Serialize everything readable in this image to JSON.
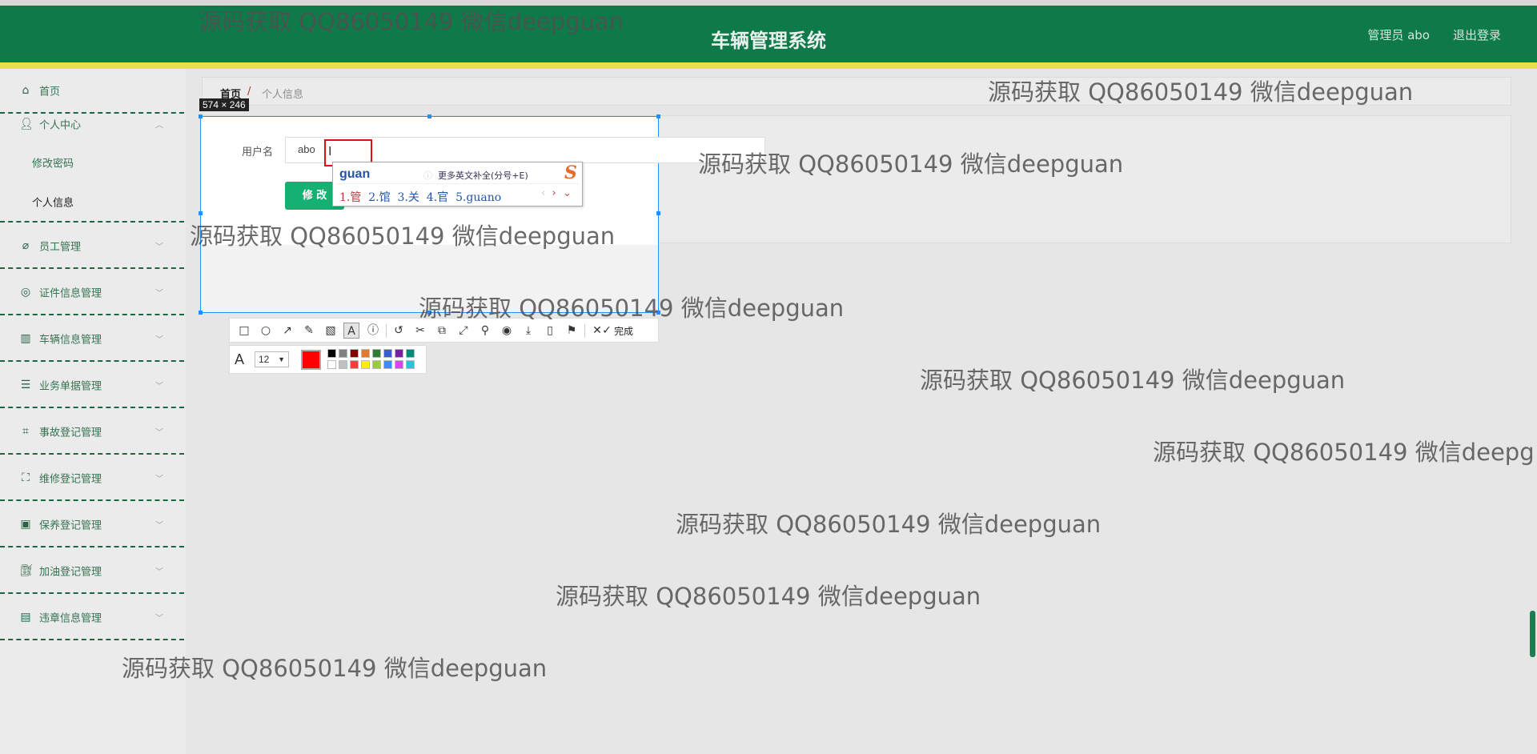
{
  "header": {
    "title": "车辆管理系统",
    "user_label": "管理员 abo",
    "logout_label": "退出登录"
  },
  "sidebar": {
    "items": [
      {
        "label": "首页",
        "icon": "home-icon"
      },
      {
        "label": "个人中心",
        "icon": "user-icon",
        "expanded": true,
        "children": [
          {
            "label": "修改密码"
          },
          {
            "label": "个人信息",
            "active": true
          }
        ]
      },
      {
        "label": "员工管理",
        "icon": "staff-icon"
      },
      {
        "label": "证件信息管理",
        "icon": "certificate-icon"
      },
      {
        "label": "车辆信息管理",
        "icon": "chart-icon"
      },
      {
        "label": "业务单据管理",
        "icon": "list-icon"
      },
      {
        "label": "事故登记管理",
        "icon": "crop-icon"
      },
      {
        "label": "维修登记管理",
        "icon": "frame-icon"
      },
      {
        "label": "保养登记管理",
        "icon": "card-icon"
      },
      {
        "label": "加油登记管理",
        "icon": "fuel-icon"
      },
      {
        "label": "违章信息管理",
        "icon": "report-icon"
      }
    ]
  },
  "breadcrumb": {
    "home": "首页",
    "separator": "/",
    "current": "个人信息"
  },
  "form": {
    "username_label": "用户名",
    "username_value": "abo",
    "submit_label": "修 改"
  },
  "snip": {
    "size_label": "574 × 246",
    "done_label": "完成",
    "font_size": "12",
    "current_color": "#ff0000",
    "swatches_row1": [
      "#000000",
      "#808080",
      "#800000",
      "#e07a2f",
      "#2e7d32",
      "#3b5bdb",
      "#7b1fa2",
      "#00897b"
    ],
    "swatches_row2": [
      "#ffffff",
      "#c0c0c0",
      "#ff3b3b",
      "#ffee00",
      "#9acd32",
      "#3d8bfd",
      "#e040fb",
      "#26c6da"
    ]
  },
  "ime": {
    "pinyin": "guan",
    "hint": "更多英文补全(分号+E)",
    "candidates": [
      "1.管",
      "2.馆",
      "3.关",
      "4.官",
      "5.guano"
    ]
  },
  "watermark": "源码获取 QQ86050149 微信deepguan",
  "watermark_partial": "源码获取 QQ86050149 微信deepg"
}
